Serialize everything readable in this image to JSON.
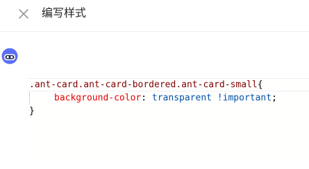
{
  "header": {
    "title": "编写样式",
    "close_icon": "close-icon"
  },
  "avatar": {
    "icon": "robot-avatar-icon",
    "color": "#5b6ef5"
  },
  "editor": {
    "lines": [
      {
        "selector": ".ant-card.ant-card-bordered.ant-card-small",
        "open_brace": "{"
      },
      {
        "property": "background-color",
        "colon": ":",
        "value": " transparent !important",
        "semicolon": ";"
      },
      {
        "close_brace": "}"
      }
    ]
  }
}
